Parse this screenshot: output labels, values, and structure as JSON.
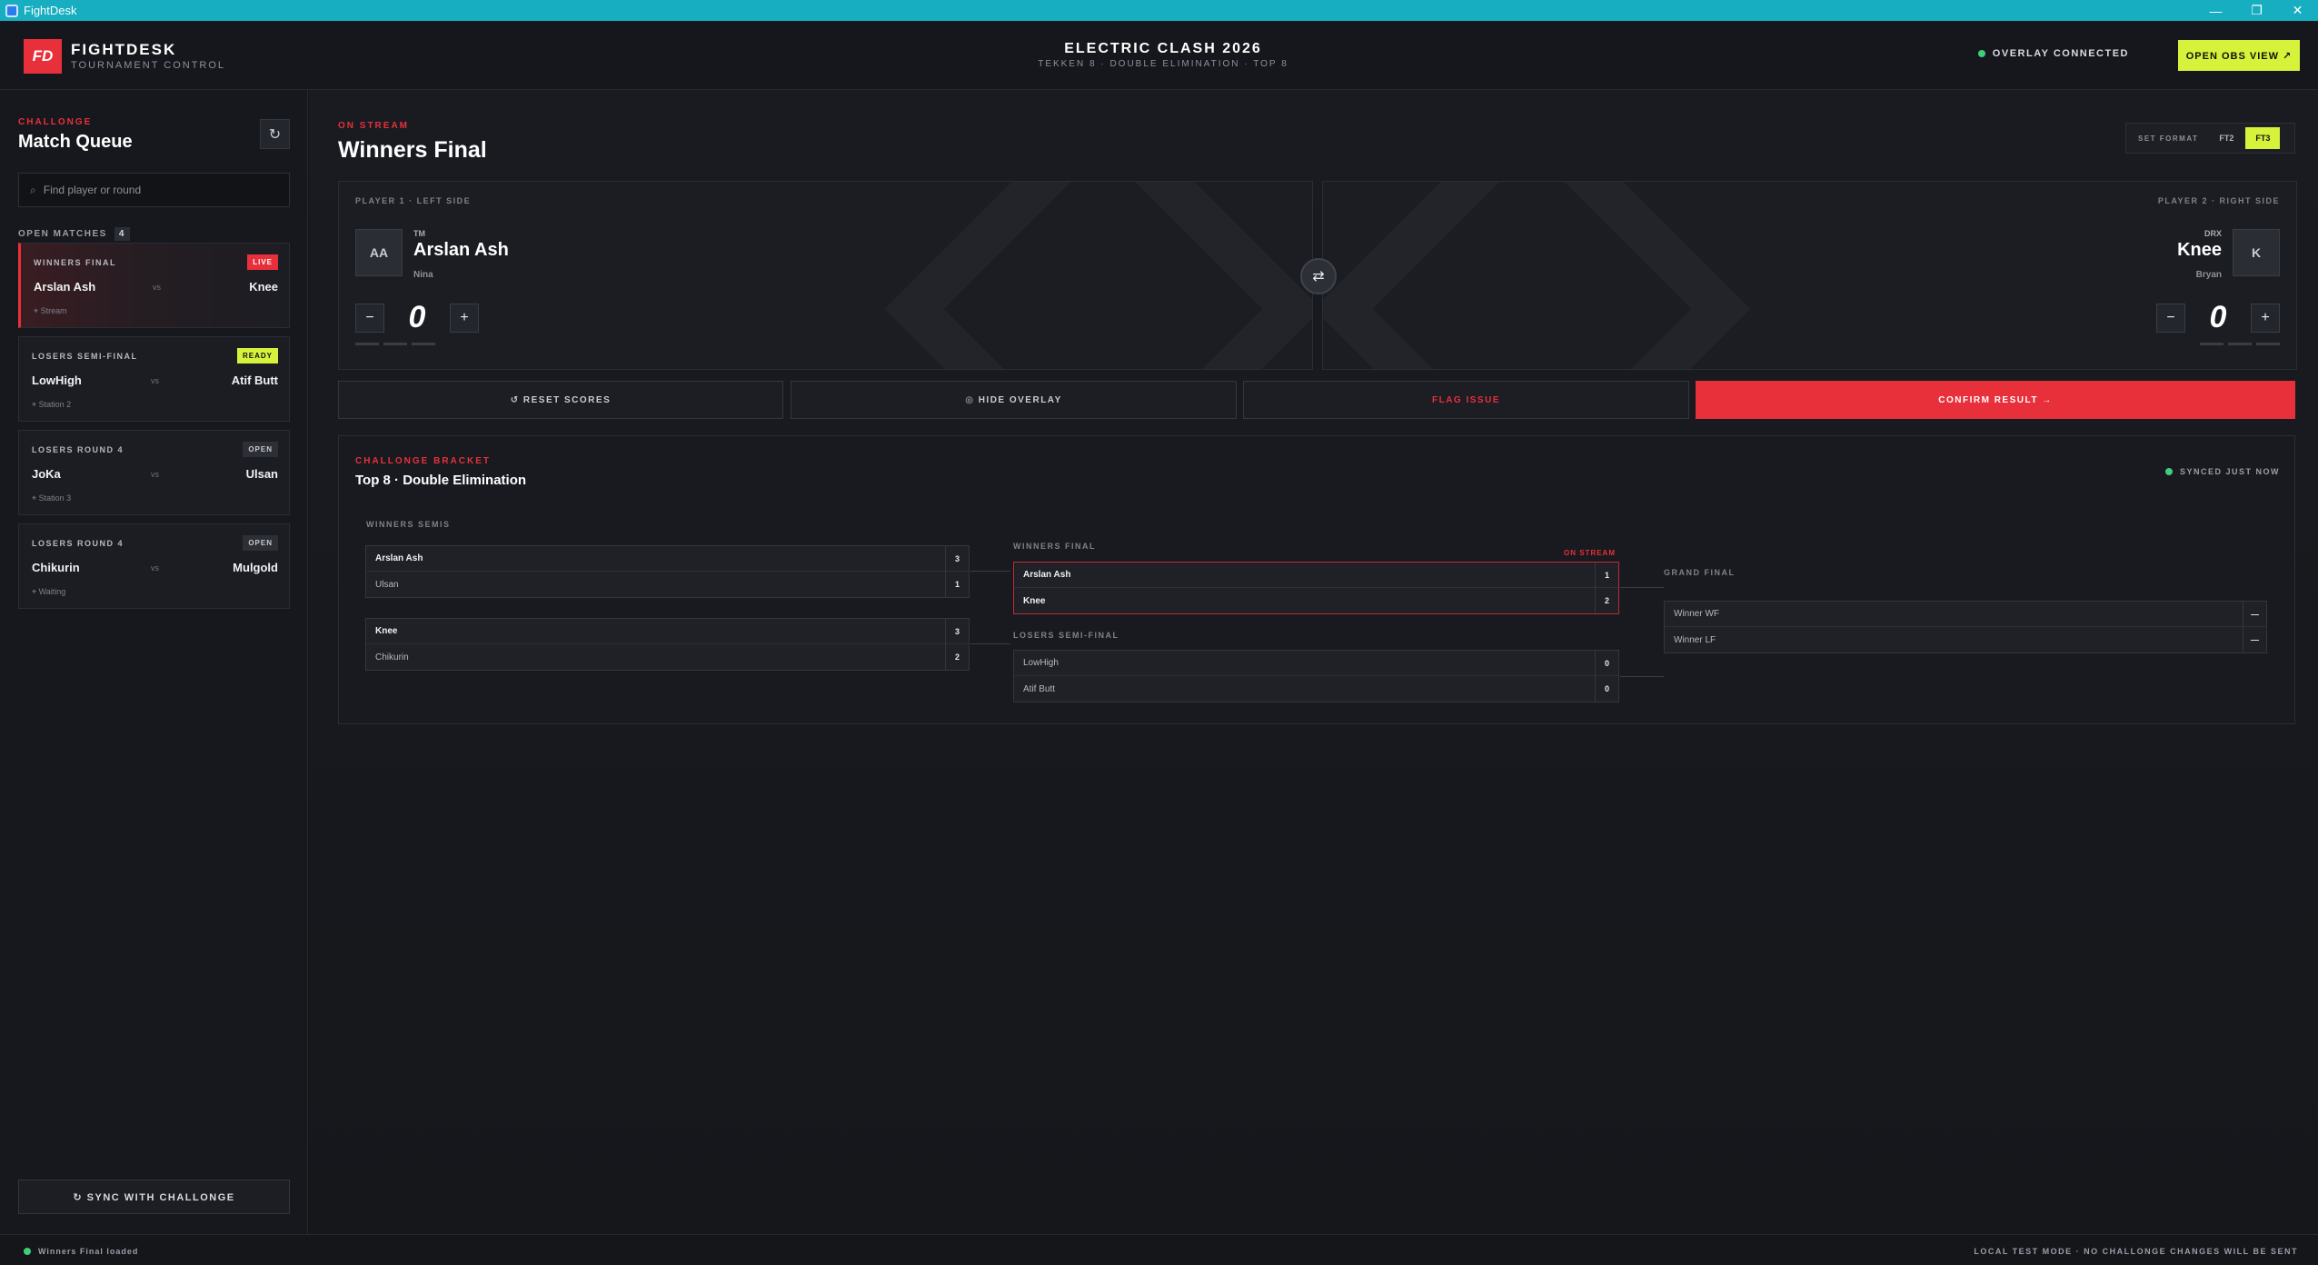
{
  "window": {
    "title": "FightDesk",
    "minimize": "—",
    "restore": "❐",
    "close": "✕"
  },
  "colors": {
    "accent_red": "#e8303b",
    "accent_lime": "#d6f23a",
    "status_green": "#3ecf7a",
    "titlebar": "#16aec0"
  },
  "header": {
    "logo_mark": "FD",
    "brand_name": "FIGHTDESK",
    "brand_sub": "TOURNAMENT CONTROL",
    "event_title": "ELECTRIC CLASH 2026",
    "event_sub": "TEKKEN 8 · DOUBLE ELIMINATION · TOP 8",
    "overlay_status": "OVERLAY CONNECTED",
    "obs_button": "OPEN OBS VIEW ↗"
  },
  "sidebar": {
    "eyebrow": "CHALLONGE",
    "title": "Match Queue",
    "refresh_icon": "↻",
    "search_icon": "⌕",
    "search_placeholder": "Find player or round",
    "open_matches_label": "OPEN MATCHES",
    "open_matches_count": "4",
    "vs": "vs",
    "matches": [
      {
        "round": "WINNERS FINAL",
        "badge": "LIVE",
        "p1": "Arslan Ash",
        "p2": "Knee",
        "station": "⌖ Stream"
      },
      {
        "round": "LOSERS SEMI-FINAL",
        "badge": "READY",
        "p1": "LowHigh",
        "p2": "Atif Butt",
        "station": "⌖ Station 2"
      },
      {
        "round": "LOSERS ROUND 4",
        "badge": "OPEN",
        "p1": "JoKa",
        "p2": "Ulsan",
        "station": "⌖ Station 3"
      },
      {
        "round": "LOSERS ROUND 4",
        "badge": "OPEN",
        "p1": "Chikurin",
        "p2": "Mulgold",
        "station": "⌖ Waiting"
      }
    ],
    "sync_button": "↻ SYNC WITH CHALLONGE"
  },
  "main": {
    "eyebrow": "ON STREAM",
    "title": "Winners Final",
    "set_format": {
      "label": "SET FORMAT",
      "options": [
        "FT2",
        "FT3"
      ],
      "selected": "FT3"
    },
    "player1": {
      "side_label": "PLAYER 1 · LEFT SIDE",
      "initials": "AA",
      "team": "TM",
      "name": "Arslan Ash",
      "character": "Nina",
      "score": "0",
      "minus": "−",
      "plus": "+"
    },
    "player2": {
      "side_label": "PLAYER 2 · RIGHT SIDE",
      "initials": "K",
      "team": "DRX",
      "name": "Knee",
      "character": "Bryan",
      "score": "0",
      "minus": "−",
      "plus": "+"
    },
    "swap_icon": "⇄",
    "actions": {
      "reset": "↺ RESET SCORES",
      "hide": "◎ HIDE OVERLAY",
      "flag": "FLAG ISSUE",
      "confirm": "CONFIRM RESULT →"
    }
  },
  "bracket": {
    "eyebrow": "CHALLONGE BRACKET",
    "title": "Top 8 · Double Elimination",
    "synced": "SYNCED JUST NOW",
    "winners_semis_label": "WINNERS SEMIS",
    "winners_final_label": "WINNERS FINAL",
    "on_stream_tag": "ON STREAM",
    "losers_semi_label": "LOSERS SEMI-FINAL",
    "grand_final_label": "GRAND FINAL",
    "ws1": [
      {
        "name": "Arslan Ash",
        "score": "3"
      },
      {
        "name": "Ulsan",
        "score": "1"
      }
    ],
    "ws2": [
      {
        "name": "Knee",
        "score": "3"
      },
      {
        "name": "Chikurin",
        "score": "2"
      }
    ],
    "wf": [
      {
        "name": "Arslan Ash",
        "score": "1"
      },
      {
        "name": "Knee",
        "score": "2"
      }
    ],
    "lsf": [
      {
        "name": "LowHigh",
        "score": "0"
      },
      {
        "name": "Atif Butt",
        "score": "0"
      }
    ],
    "gf": [
      {
        "name": "Winner WF",
        "score": "—"
      },
      {
        "name": "Winner LF",
        "score": "—"
      }
    ]
  },
  "footer": {
    "status": "Winners Final loaded",
    "mode": "LOCAL TEST MODE · NO CHALLONGE CHANGES WILL BE SENT"
  }
}
